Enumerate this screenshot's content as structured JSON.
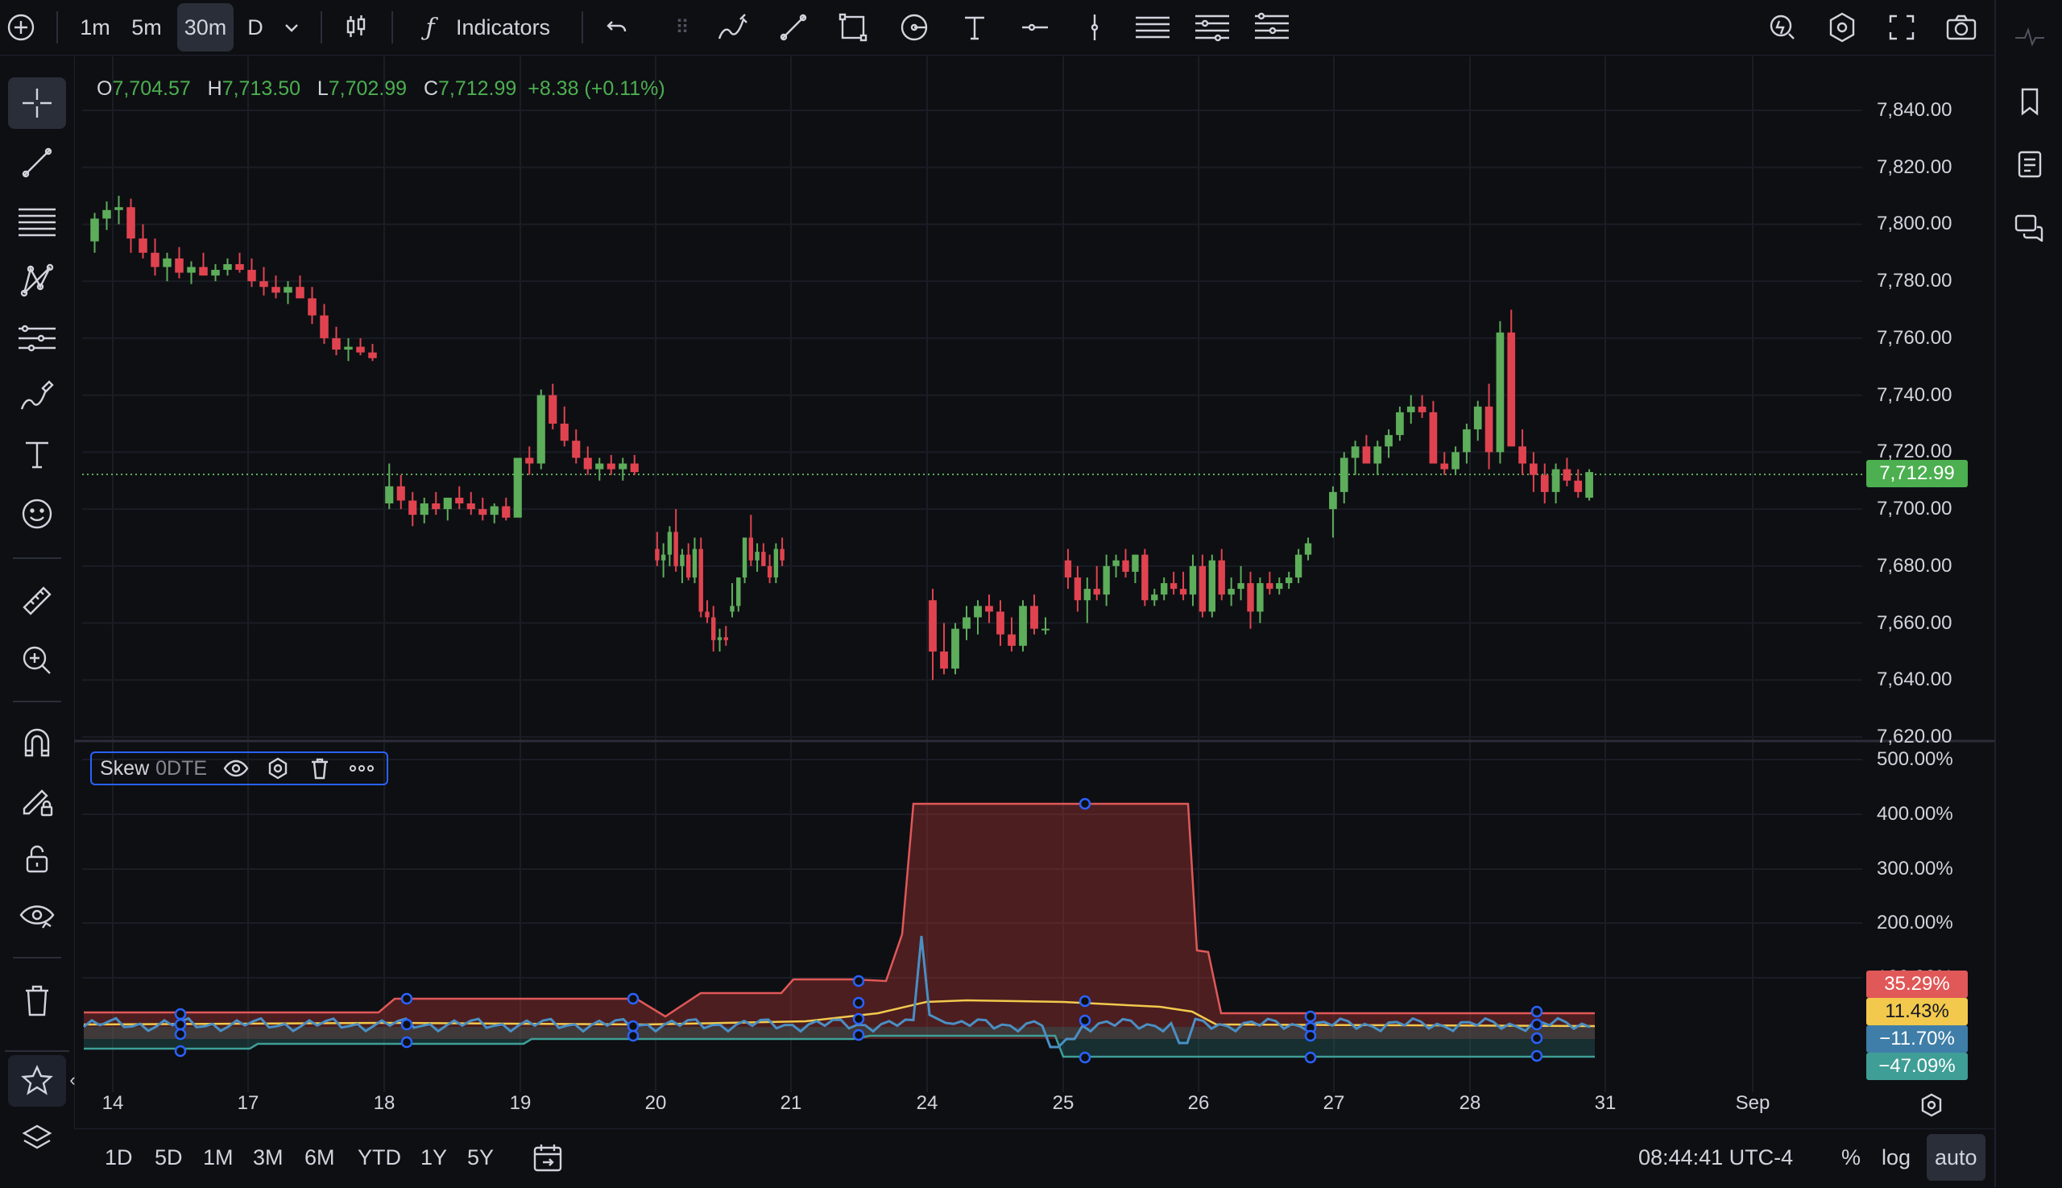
{
  "toolbar": {
    "intervals": [
      "1m",
      "5m",
      "30m",
      "D"
    ],
    "active_interval": "30m",
    "indicators_label": "Indicators"
  },
  "ohlc": {
    "o_label": "O",
    "o": "7,704.57",
    "h_label": "H",
    "h": "7,713.50",
    "l_label": "L",
    "l": "7,702.99",
    "c_label": "C",
    "c": "7,712.99",
    "change": "+8.38 (+0.11%)"
  },
  "indicator_legend": {
    "name": "Skew",
    "param": "0DTE"
  },
  "price_axis": {
    "ticks": [
      "7,840.00",
      "7,820.00",
      "7,800.00",
      "7,780.00",
      "7,760.00",
      "7,740.00",
      "7,720.00",
      "7,700.00",
      "7,680.00",
      "7,660.00",
      "7,640.00",
      "7,620.00"
    ],
    "last_price": "7,712.99"
  },
  "skew_axis": {
    "ticks": [
      "500.00%",
      "400.00%",
      "300.00%",
      "200.00%",
      "100.00%"
    ],
    "values": [
      {
        "label": "35.29%",
        "color": "#e05858"
      },
      {
        "label": "11.43%",
        "color": "#f2c94c"
      },
      {
        "label": "−11.70%",
        "color": "#3f7ea8"
      },
      {
        "label": "−47.09%",
        "color": "#3f9e96"
      }
    ]
  },
  "time_axis": {
    "labels": [
      "14",
      "17",
      "18",
      "19",
      "20",
      "21",
      "24",
      "25",
      "26",
      "27",
      "28",
      "31",
      "Sep"
    ]
  },
  "bottom": {
    "ranges": [
      "1D",
      "5D",
      "1M",
      "3M",
      "6M",
      "YTD",
      "1Y",
      "5Y"
    ],
    "clock": "08:44:41 UTC-4",
    "percent": "%",
    "log": "log",
    "auto": "auto"
  },
  "colors": {
    "up": "#5dad5b",
    "down": "#e0434f",
    "bg": "#0e0f13"
  },
  "chart_data": {
    "type": "candlestick",
    "price_range": [
      7620,
      7850
    ],
    "x_dates": [
      "14",
      "17",
      "18",
      "19",
      "20",
      "21",
      "24",
      "25",
      "26",
      "27",
      "28",
      "31"
    ],
    "candles": [
      [
        7794,
        7804,
        7790,
        7802
      ],
      [
        7802,
        7808,
        7798,
        7805
      ],
      [
        7805,
        7810,
        7800,
        7806
      ],
      [
        7806,
        7809,
        7790,
        7795
      ],
      [
        7795,
        7800,
        7788,
        7790
      ],
      [
        7790,
        7795,
        7782,
        7785
      ],
      [
        7785,
        7790,
        7780,
        7788
      ],
      [
        7788,
        7792,
        7781,
        7783
      ],
      [
        7783,
        7787,
        7779,
        7785
      ],
      [
        7785,
        7790,
        7782,
        7782
      ],
      [
        7782,
        7786,
        7780,
        7784
      ],
      [
        7784,
        7788,
        7782,
        7786
      ],
      [
        7786,
        7790,
        7783,
        7784
      ],
      [
        7784,
        7788,
        7778,
        7780
      ],
      [
        7780,
        7785,
        7775,
        7778
      ],
      [
        7778,
        7782,
        7774,
        7776
      ],
      [
        7776,
        7780,
        7772,
        7778
      ],
      [
        7778,
        7782,
        7774,
        7774
      ],
      [
        7774,
        7778,
        7765,
        7768
      ],
      [
        7768,
        7772,
        7758,
        7760
      ],
      [
        7760,
        7764,
        7754,
        7756
      ],
      [
        7756,
        7760,
        7752,
        7757
      ],
      [
        7757,
        7760,
        7754,
        7755
      ],
      [
        7755,
        7758,
        7752,
        7753
      ],
      [
        7702,
        7716,
        7700,
        7708
      ],
      [
        7708,
        7712,
        7700,
        7703
      ],
      [
        7703,
        7706,
        7694,
        7698
      ],
      [
        7698,
        7704,
        7695,
        7702
      ],
      [
        7702,
        7706,
        7698,
        7700
      ],
      [
        7700,
        7704,
        7696,
        7704
      ],
      [
        7704,
        7708,
        7700,
        7702
      ],
      [
        7702,
        7706,
        7698,
        7700
      ],
      [
        7700,
        7704,
        7696,
        7698
      ],
      [
        7698,
        7702,
        7695,
        7701
      ],
      [
        7701,
        7704,
        7696,
        7697
      ],
      [
        7697,
        7712,
        7700,
        7718
      ],
      [
        7718,
        7722,
        7712,
        7716
      ],
      [
        7716,
        7742,
        7714,
        7740
      ],
      [
        7740,
        7744,
        7728,
        7730
      ],
      [
        7730,
        7736,
        7722,
        7724
      ],
      [
        7724,
        7728,
        7716,
        7718
      ],
      [
        7718,
        7722,
        7712,
        7714
      ],
      [
        7714,
        7718,
        7710,
        7716
      ],
      [
        7716,
        7719,
        7712,
        7714
      ],
      [
        7714,
        7718,
        7710,
        7716
      ],
      [
        7716,
        7719,
        7712,
        7713
      ],
      [
        7686,
        7692,
        7680,
        7682
      ],
      [
        7682,
        7688,
        7676,
        7684
      ],
      [
        7684,
        7694,
        7680,
        7692
      ],
      [
        7692,
        7700,
        7678,
        7680
      ],
      [
        7680,
        7686,
        7674,
        7684
      ],
      [
        7684,
        7688,
        7675,
        7676
      ],
      [
        7676,
        7690,
        7674,
        7686
      ],
      [
        7686,
        7690,
        7662,
        7664
      ],
      [
        7664,
        7668,
        7660,
        7662
      ],
      [
        7662,
        7666,
        7650,
        7654
      ],
      [
        7654,
        7658,
        7650,
        7655
      ],
      [
        7655,
        7659,
        7652,
        7654
      ],
      [
        7664,
        7674,
        7662,
        7666
      ],
      [
        7666,
        7676,
        7664,
        7676
      ],
      [
        7676,
        7690,
        7674,
        7690
      ],
      [
        7690,
        7698,
        7680,
        7682
      ],
      [
        7682,
        7688,
        7678,
        7685
      ],
      [
        7685,
        7688,
        7680,
        7680
      ],
      [
        7680,
        7684,
        7674,
        7676
      ],
      [
        7676,
        7688,
        7674,
        7686
      ],
      [
        7686,
        7690,
        7680,
        7682
      ],
      [
        7668,
        7672,
        7640,
        7650
      ],
      [
        7650,
        7660,
        7642,
        7644
      ],
      [
        7644,
        7660,
        7642,
        7658
      ],
      [
        7658,
        7666,
        7654,
        7662
      ],
      [
        7662,
        7668,
        7656,
        7666
      ],
      [
        7666,
        7670,
        7660,
        7664
      ],
      [
        7664,
        7668,
        7652,
        7656
      ],
      [
        7656,
        7662,
        7650,
        7652
      ],
      [
        7652,
        7668,
        7650,
        7666
      ],
      [
        7666,
        7670,
        7656,
        7658
      ],
      [
        7658,
        7662,
        7656,
        7658
      ],
      [
        7682,
        7686,
        7672,
        7676
      ],
      [
        7676,
        7680,
        7664,
        7668
      ],
      [
        7668,
        7676,
        7660,
        7672
      ],
      [
        7672,
        7680,
        7668,
        7670
      ],
      [
        7670,
        7684,
        7666,
        7680
      ],
      [
        7680,
        7684,
        7676,
        7682
      ],
      [
        7682,
        7686,
        7676,
        7678
      ],
      [
        7678,
        7684,
        7674,
        7684
      ],
      [
        7684,
        7686,
        7666,
        7668
      ],
      [
        7668,
        7672,
        7666,
        7670
      ],
      [
        7670,
        7676,
        7668,
        7674
      ],
      [
        7674,
        7678,
        7670,
        7672
      ],
      [
        7672,
        7678,
        7668,
        7670
      ],
      [
        7670,
        7684,
        7666,
        7680
      ],
      [
        7680,
        7684,
        7662,
        7664
      ],
      [
        7664,
        7684,
        7662,
        7682
      ],
      [
        7682,
        7686,
        7668,
        7670
      ],
      [
        7670,
        7676,
        7666,
        7672
      ],
      [
        7672,
        7680,
        7668,
        7674
      ],
      [
        7674,
        7678,
        7658,
        7664
      ],
      [
        7664,
        7676,
        7660,
        7674
      ],
      [
        7674,
        7678,
        7670,
        7672
      ],
      [
        7672,
        7676,
        7670,
        7674
      ],
      [
        7674,
        7678,
        7672,
        7676
      ],
      [
        7676,
        7686,
        7674,
        7684
      ],
      [
        7684,
        7690,
        7682,
        7688
      ],
      [
        7700,
        7708,
        7690,
        7706
      ],
      [
        7706,
        7720,
        7702,
        7718
      ],
      [
        7718,
        7724,
        7712,
        7722
      ],
      [
        7722,
        7726,
        7716,
        7716
      ],
      [
        7716,
        7724,
        7712,
        7722
      ],
      [
        7722,
        7728,
        7718,
        7726
      ],
      [
        7726,
        7736,
        7724,
        7734
      ],
      [
        7734,
        7740,
        7730,
        7736
      ],
      [
        7736,
        7740,
        7732,
        7734
      ],
      [
        7734,
        7738,
        7716,
        7716
      ],
      [
        7716,
        7720,
        7712,
        7714
      ],
      [
        7714,
        7722,
        7712,
        7720
      ],
      [
        7720,
        7730,
        7716,
        7728
      ],
      [
        7728,
        7738,
        7724,
        7736
      ],
      [
        7736,
        7744,
        7714,
        7720
      ],
      [
        7720,
        7766,
        7716,
        7762
      ],
      [
        7762,
        7770,
        7740,
        7722
      ],
      [
        7722,
        7728,
        7712,
        7716
      ],
      [
        7716,
        7720,
        7706,
        7712
      ],
      [
        7712,
        7716,
        7702,
        7706
      ],
      [
        7706,
        7716,
        7702,
        7714
      ],
      [
        7714,
        7718,
        7708,
        7710
      ],
      [
        7710,
        7714,
        7704,
        7706
      ],
      [
        7704,
        7714,
        7703,
        7713
      ]
    ],
    "skew_series": [
      {
        "name": "35.29%",
        "color": "#e05858"
      },
      {
        "name": "11.43%",
        "color": "#f2c94c"
      },
      {
        "name": "−11.70%",
        "color": "#3f7ea8"
      },
      {
        "name": "−47.09%",
        "color": "#3f9e96"
      }
    ]
  }
}
